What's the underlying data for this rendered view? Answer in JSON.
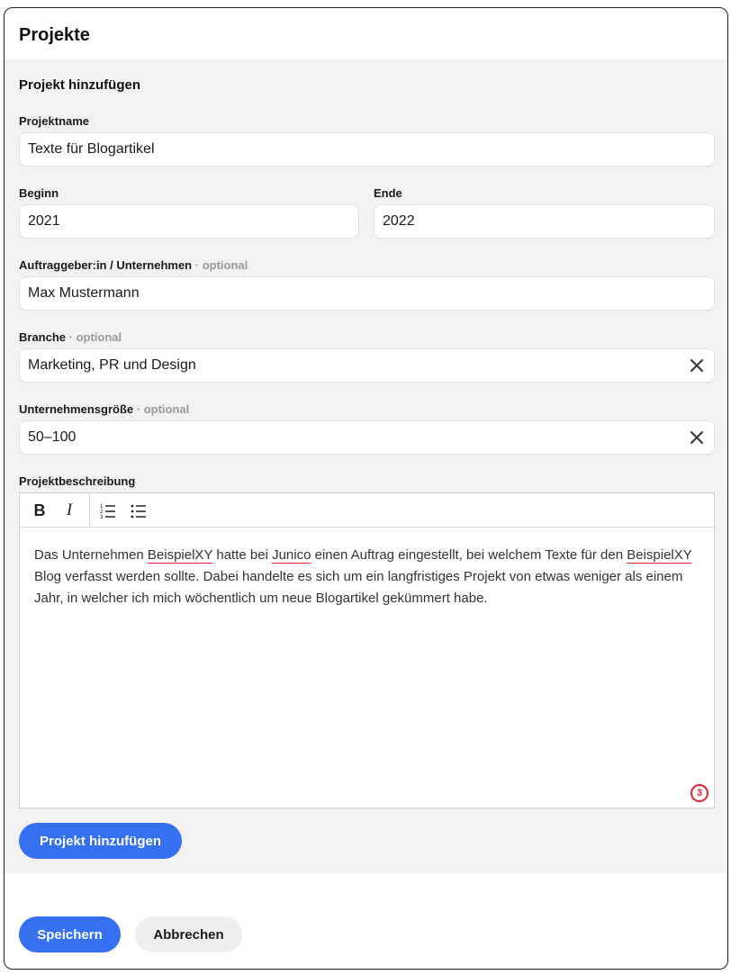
{
  "panel": {
    "title": "Projekte"
  },
  "form": {
    "heading": "Projekt hinzufügen",
    "project_name": {
      "label": "Projektname",
      "value": "Texte für Blogartikel"
    },
    "begin": {
      "label": "Beginn",
      "value": "2021"
    },
    "end": {
      "label": "Ende",
      "value": "2022"
    },
    "client": {
      "label": "Auftraggeber:in / Unternehmen",
      "optional": "· optional",
      "value": "Max Mustermann"
    },
    "industry": {
      "label": "Branche",
      "optional": "· optional",
      "value": "Marketing, PR und Design",
      "clear_icon": "close-icon"
    },
    "company_size": {
      "label": "Unternehmensgröße",
      "optional": "· optional",
      "value": "50–100",
      "clear_icon": "close-icon"
    },
    "description": {
      "label": "Projektbeschreibung",
      "toolbar": {
        "bold": "B",
        "italic": "I",
        "ordered_list_icon": "ordered-list-icon",
        "bullet_list_icon": "bullet-list-icon"
      },
      "text": {
        "t1": "Das Unternehmen ",
        "w1": "BeispielXY",
        "t2": " hatte bei ",
        "w2": "Junico",
        "t3": " einen Auftrag eingestellt, bei welchem Texte für den ",
        "w3": "BeispielXY",
        "t4": " Blog verfasst werden sollte. Dabei handelte es sich um ein langfristiges Projekt von etwas weniger als einem Jahr, in welcher ich mich wöchentlich um neue Blogartikel gekümmert habe."
      },
      "issue_count": "3"
    },
    "add_button": "Projekt hinzufügen"
  },
  "footer": {
    "save_button": "Speichern",
    "cancel_button": "Abbrechen"
  },
  "colors": {
    "primary": "#3470f0",
    "spell_error": "#e0242f",
    "form_bg": "#f2f2f2"
  }
}
